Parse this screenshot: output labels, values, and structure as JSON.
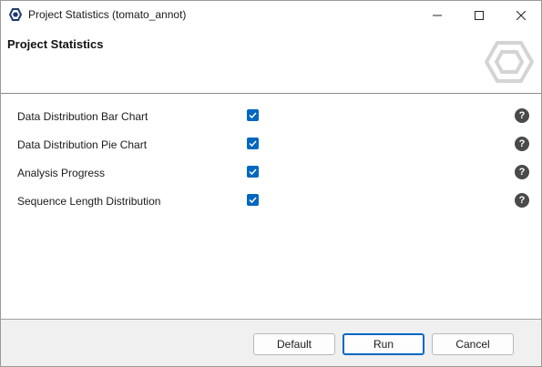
{
  "window": {
    "title": "Project Statistics (tomato_annot)"
  },
  "header": {
    "title": "Project Statistics"
  },
  "options": [
    {
      "label": "Data Distribution Bar Chart",
      "checked": true,
      "help": "?"
    },
    {
      "label": "Data Distribution Pie Chart",
      "checked": true,
      "help": "?"
    },
    {
      "label": "Analysis Progress",
      "checked": true,
      "help": "?"
    },
    {
      "label": "Sequence Length Distribution",
      "checked": true,
      "help": "?"
    }
  ],
  "footer": {
    "default_label": "Default",
    "run_label": "Run",
    "cancel_label": "Cancel"
  },
  "colors": {
    "accent": "#0067c0",
    "help_icon": "#4a4a4a"
  },
  "icons": {
    "app": "app-logo-icon",
    "minimize": "minimize-icon",
    "maximize": "maximize-icon",
    "close": "close-icon",
    "header_logo": "hexagon-logo-icon",
    "checkbox": "checkmark-icon",
    "help": "help-icon"
  }
}
